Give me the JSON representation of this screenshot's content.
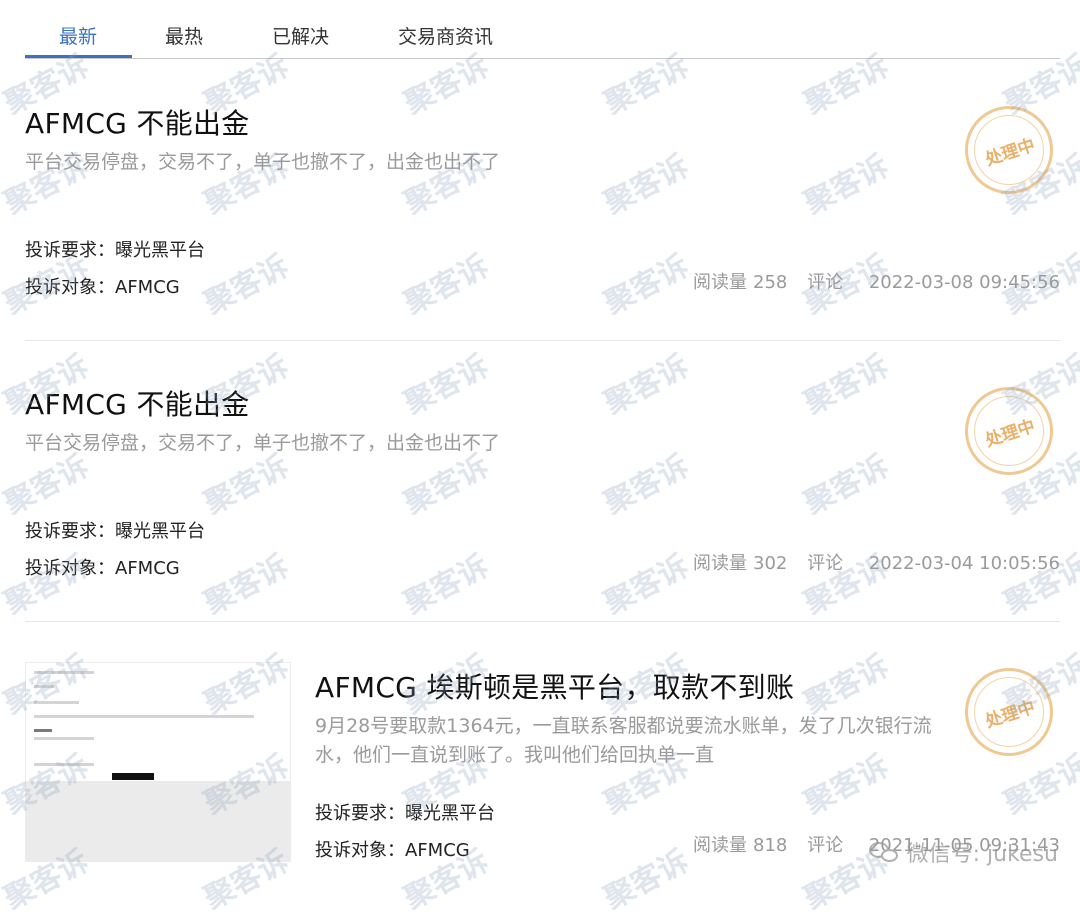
{
  "tabs": [
    {
      "label": "最新",
      "active": true
    },
    {
      "label": "最热",
      "active": false
    },
    {
      "label": "已解决",
      "active": false
    },
    {
      "label": "交易商资讯",
      "active": false
    }
  ],
  "complaints": [
    {
      "title": "AFMCG 不能出金",
      "description": "平台交易停盘，交易不了，单子也撤不了，出金也出不了",
      "demand": "投诉要求：曝光黑平台",
      "target": "投诉对象：AFMCG",
      "reads_label": "阅读量",
      "reads": "258",
      "comments_label": "评论",
      "datetime": "2022-03-08 09:45:56",
      "status": "处理中"
    },
    {
      "title": "AFMCG 不能出金",
      "description": "平台交易停盘，交易不了，单子也撤不了，出金也出不了",
      "demand": "投诉要求：曝光黑平台",
      "target": "投诉对象：AFMCG",
      "reads_label": "阅读量",
      "reads": "302",
      "comments_label": "评论",
      "datetime": "2022-03-04 10:05:56",
      "status": "处理中"
    },
    {
      "title": "AFMCG 埃斯顿是黑平台，取款不到账",
      "description": "9月28号要取款1364元，一直联系客服都说要流水账单，发了几次银行流水，他们一直说到账了。我叫他们给回执单一直",
      "demand": "投诉要求：曝光黑平台",
      "target": "投诉对象：AFMCG",
      "reads_label": "阅读量",
      "reads": "818",
      "comments_label": "评论",
      "datetime": "2021-11-05 09:31:43",
      "status": "处理中"
    }
  ],
  "watermark": {
    "text": "聚客诉",
    "color": "#8ca0be"
  },
  "footer_watermark": "微信号: jukesu",
  "colors": {
    "accent": "#3b73c4",
    "stamp": "#eab06a",
    "muted": "#9a9a9a"
  }
}
